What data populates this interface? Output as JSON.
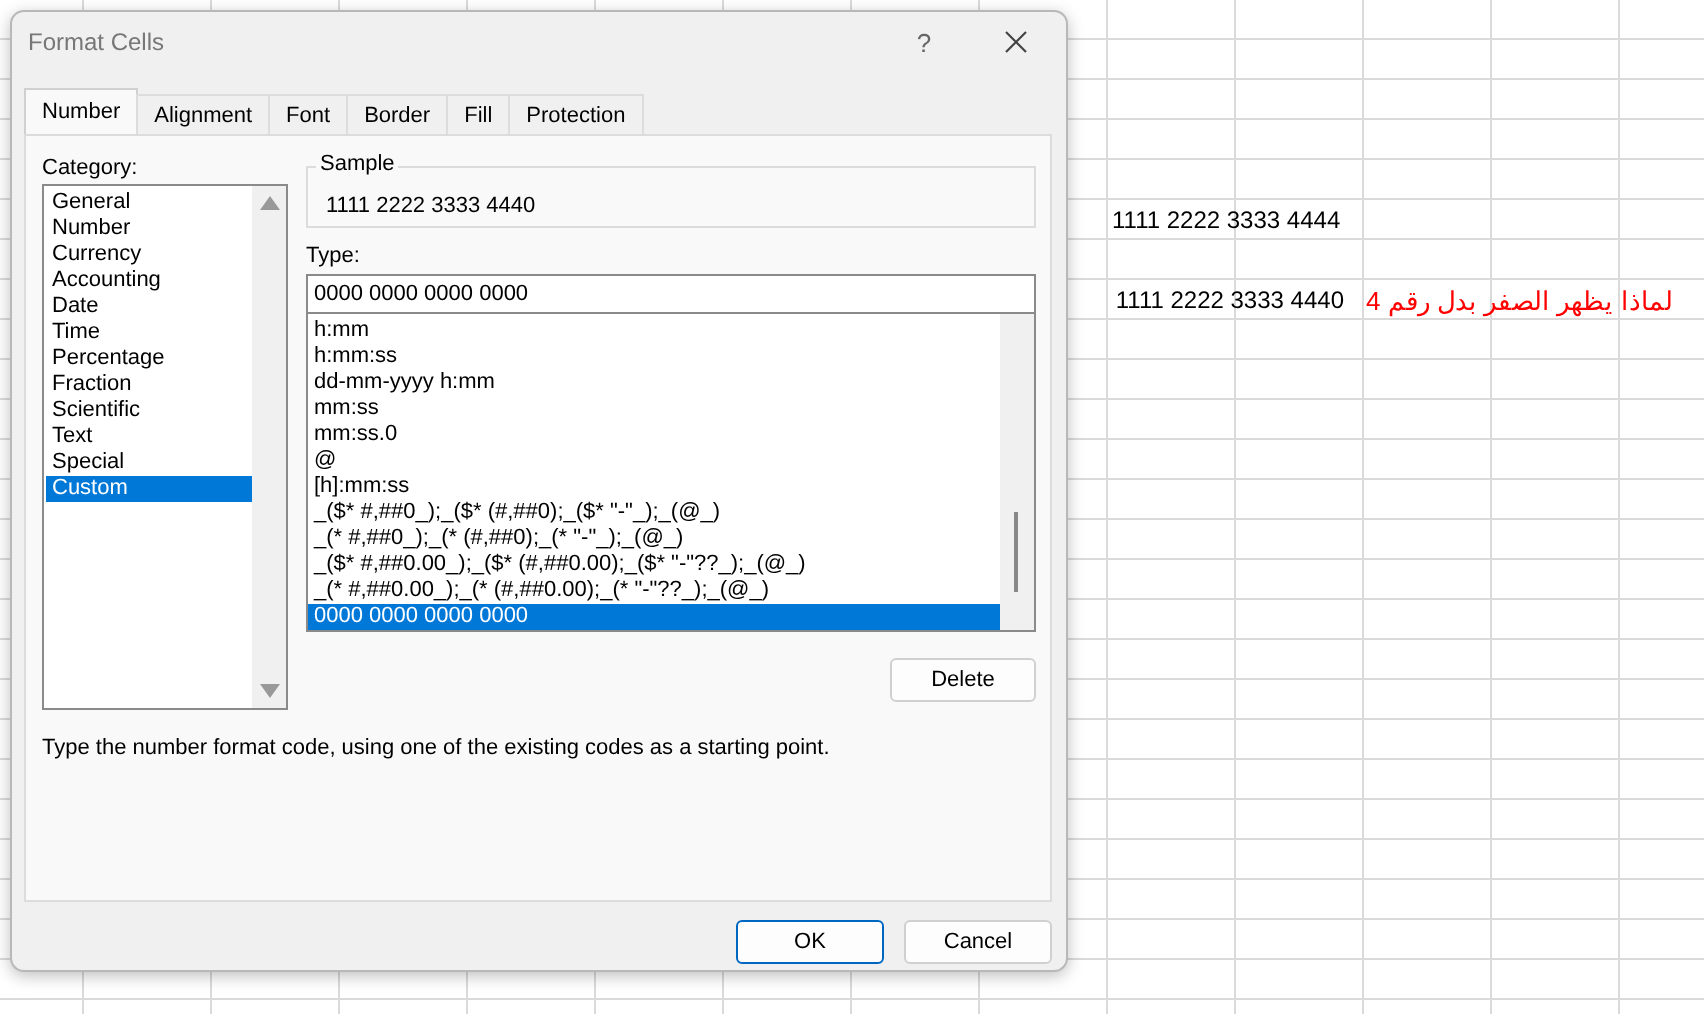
{
  "window": {
    "title": "Format Cells",
    "help": "?"
  },
  "tabs": [
    {
      "label": "Number",
      "selected": true
    },
    {
      "label": "Alignment",
      "selected": false
    },
    {
      "label": "Font",
      "selected": false
    },
    {
      "label": "Border",
      "selected": false
    },
    {
      "label": "Fill",
      "selected": false
    },
    {
      "label": "Protection",
      "selected": false
    }
  ],
  "category": {
    "label": "Category:",
    "items": [
      {
        "label": "General",
        "selected": false
      },
      {
        "label": "Number",
        "selected": false
      },
      {
        "label": "Currency",
        "selected": false
      },
      {
        "label": "Accounting",
        "selected": false
      },
      {
        "label": "Date",
        "selected": false
      },
      {
        "label": "Time",
        "selected": false
      },
      {
        "label": "Percentage",
        "selected": false
      },
      {
        "label": "Fraction",
        "selected": false
      },
      {
        "label": "Scientific",
        "selected": false
      },
      {
        "label": "Text",
        "selected": false
      },
      {
        "label": "Special",
        "selected": false
      },
      {
        "label": "Custom",
        "selected": true
      }
    ]
  },
  "sample": {
    "label": "Sample",
    "value": "1111 2222 3333 4440"
  },
  "type": {
    "label": "Type:",
    "value": "0000 0000 0000 0000",
    "items": [
      {
        "label": "h:mm",
        "selected": false
      },
      {
        "label": "h:mm:ss",
        "selected": false
      },
      {
        "label": "dd-mm-yyyy h:mm",
        "selected": false
      },
      {
        "label": "mm:ss",
        "selected": false
      },
      {
        "label": "mm:ss.0",
        "selected": false
      },
      {
        "label": "@",
        "selected": false
      },
      {
        "label": "[h]:mm:ss",
        "selected": false
      },
      {
        "label": "_($* #,##0_);_($* (#,##0);_($* \"-\"_);_(@_)",
        "selected": false
      },
      {
        "label": "_(* #,##0_);_(* (#,##0);_(* \"-\"_);_(@_)",
        "selected": false
      },
      {
        "label": "_($* #,##0.00_);_($* (#,##0.00);_($* \"-\"??_);_(@_)",
        "selected": false
      },
      {
        "label": "_(* #,##0.00_);_(* (#,##0.00);_(* \"-\"??_);_(@_)",
        "selected": false
      },
      {
        "label": "0000 0000 0000 0000",
        "selected": true
      }
    ]
  },
  "delete_button": "Delete",
  "description": "Type the number format code, using one of the existing codes as a starting point.",
  "buttons": [
    {
      "label": "OK",
      "default": true
    },
    {
      "label": "Cancel",
      "default": false
    }
  ],
  "sheet": {
    "cells": [
      {
        "text": "1111 2222 3333 4444",
        "color": "#000000"
      },
      {
        "text": "1111 2222 3333 4440",
        "color": "#000000"
      },
      {
        "text": "لماذا يظهر الصفر بدل رقم 4",
        "color": "#ff0000"
      }
    ]
  }
}
